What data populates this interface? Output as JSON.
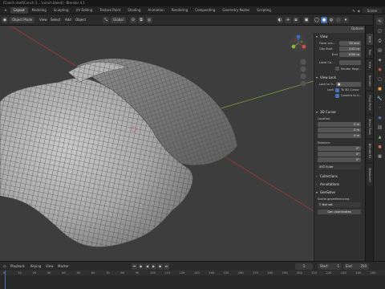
{
  "titlebar": {
    "title": "[Conch shell\\Conch 3 ...\\conch.blend] - Blender 4.1"
  },
  "topbar": {
    "tabs": [
      "Layout",
      "Modeling",
      "Sculpting",
      "UV Editing",
      "Texture Paint",
      "Shading",
      "Animation",
      "Rendering",
      "Compositing",
      "Geometry Nodes",
      "Scripting"
    ],
    "active_tab": "Layout",
    "scene_label": "Scene"
  },
  "header": {
    "mode_label": "Object Mode",
    "view_menu": "View",
    "select_menu": "Select",
    "add_menu": "Add",
    "object_menu": "Object",
    "transform_space": "Global",
    "options_label": "Options",
    "add_label_short": "Add"
  },
  "npanel": {
    "view_section": "View",
    "focal_label": "Focal Len...",
    "focal_value": "50 mm",
    "clip_start_label": "Clip Start",
    "clip_start_value": "0.01 m",
    "clip_end_label": "End",
    "clip_end_value": "1000 m",
    "local_camera_label": "Local Ca...",
    "render_region_label": "Render Regi...",
    "view_lock_section": "View Lock",
    "lock_to_object_label": "Lock to O...",
    "lock_label": "Lock",
    "to_3d_cursor_label": "To 3D Cursor",
    "camera_to_view_label": "Camera to V...",
    "cursor_section": "3D Cursor",
    "location_label": "Location:",
    "loc_x": "0 m",
    "loc_y": "0 m",
    "loc_z": "0 m",
    "rotation_label": "Rotation:",
    "rot_x": "0°",
    "rot_y": "0°",
    "rot_z": "0°",
    "rotation_mode": "XYZ Euler",
    "collections_section": "Collections",
    "annotations_section": "Annotations",
    "gensolve_section": "GenSolve",
    "scene_georef_label": "Scene georeferencing :",
    "crs_label": "C  Not set",
    "get_coords_label": "Gen coordinates"
  },
  "tabstrip": [
    "Item",
    "Tool",
    "View",
    "Blender",
    "Pivot Point",
    "Mesh Tools",
    "BlenderKit",
    "MeasureIt"
  ],
  "timeline": {
    "playback_label": "Playback",
    "keying_label": "Keying",
    "view_label": "View",
    "marker_label": "Marker",
    "current_frame": "1",
    "start_label": "Start",
    "start_value": "1",
    "end_label": "End",
    "end_value": "250",
    "ticks": [
      "0",
      "10",
      "20",
      "30",
      "40",
      "50",
      "60",
      "70",
      "80",
      "90",
      "100",
      "110",
      "120",
      "130",
      "140",
      "150",
      "160",
      "170",
      "180",
      "190",
      "200",
      "210",
      "220",
      "230",
      "240",
      "250"
    ]
  },
  "colors": {
    "accent": "#4772b3",
    "x_axis": "#a03838",
    "y_axis": "#7a9a3a",
    "z_axis": "#3d6bb8",
    "viewport_bg": "#3d3d3d"
  }
}
